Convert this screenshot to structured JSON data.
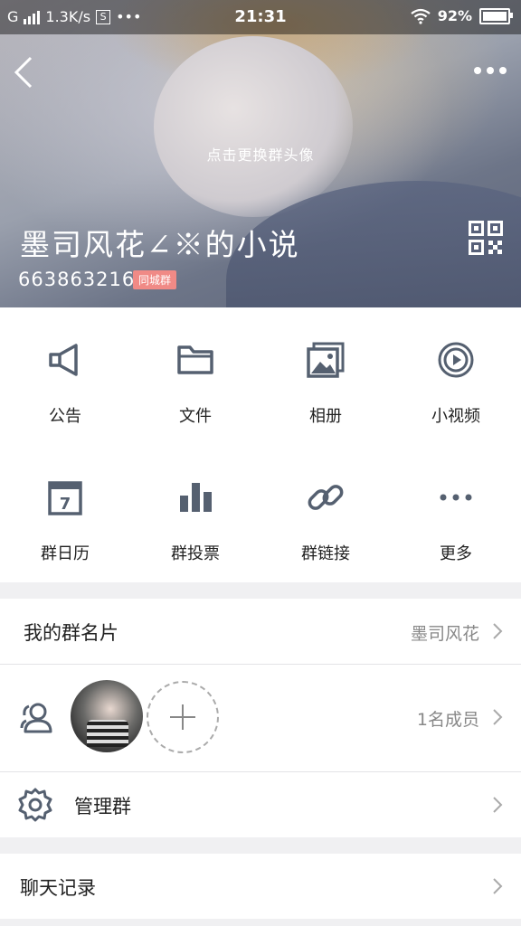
{
  "status_bar": {
    "network": "G",
    "speed": "1.3K/s",
    "sim_icon": "S",
    "more": "•••",
    "time": "21:31",
    "battery_percent": "92%"
  },
  "header": {
    "change_avatar_hint": "点击更换群头像",
    "group_name": "墨司风花∠※的小说",
    "group_id": "663863216",
    "city_badge": "同城群"
  },
  "features": [
    {
      "label": "公告",
      "icon": "megaphone-icon"
    },
    {
      "label": "文件",
      "icon": "folder-icon"
    },
    {
      "label": "相册",
      "icon": "album-icon"
    },
    {
      "label": "小视频",
      "icon": "video-icon"
    },
    {
      "label": "群日历",
      "icon": "calendar-icon"
    },
    {
      "label": "群投票",
      "icon": "poll-icon"
    },
    {
      "label": "群链接",
      "icon": "link-icon"
    },
    {
      "label": "更多",
      "icon": "more-icon"
    }
  ],
  "calendar_day": "7",
  "my_card": {
    "title": "我的群名片",
    "value": "墨司风花"
  },
  "members": {
    "count_label": "1名成员"
  },
  "manage": {
    "title": "管理群"
  },
  "chat_history": {
    "title": "聊天记录"
  },
  "colors": {
    "icon": "#556070",
    "badge": "#f08a86",
    "background": "#f0f0f2"
  }
}
